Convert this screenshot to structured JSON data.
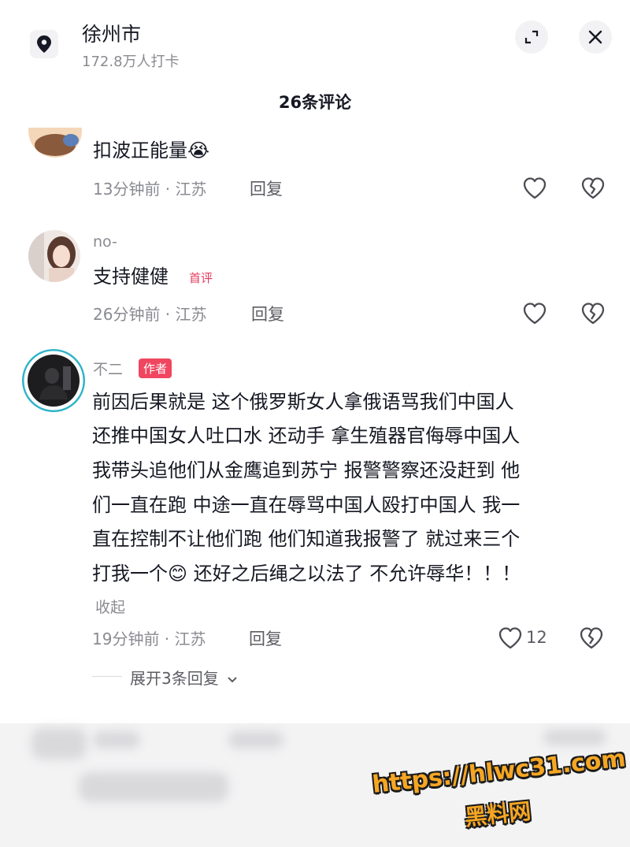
{
  "header": {
    "location": "徐州市",
    "checkins": "172.8万人打卡",
    "comment_count": "26条评论"
  },
  "comments": [
    {
      "username": "",
      "content": "扣波正能量😭",
      "time_location": "13分钟前 · 江苏",
      "reply_label": "回复"
    },
    {
      "username": "no-",
      "content": "支持健健",
      "badge": "首评",
      "time_location": "26分钟前 · 江苏",
      "reply_label": "回复"
    },
    {
      "username": "不二",
      "badge": "作者",
      "content_lines": [
        "前因后果就是 这个俄罗斯女人拿俄语骂我们中国人",
        "还推中国女人吐口水 还动手 拿生殖器官侮辱中国人",
        "我带头追他们从金鹰追到苏宁 报警警察还没赶到 他",
        "们一直在跑 中途一直在辱骂中国人殴打中国人 我一",
        "直在控制不让他们跑 他们知道我报警了 就过来三个",
        "打我一个😊 还好之后绳之以法了 不允许辱华！！！"
      ],
      "collapse_label": "收起",
      "time_location": "19分钟前 · 江苏",
      "reply_label": "回复",
      "likes": "12",
      "expand_replies": "展开3条回复"
    }
  ],
  "watermark": {
    "url": "https://hlwc31.com",
    "name": "黑料网"
  },
  "colors": {
    "accent_red": "#f0465f",
    "text_primary": "#161823",
    "text_secondary": "#8a8b91"
  }
}
